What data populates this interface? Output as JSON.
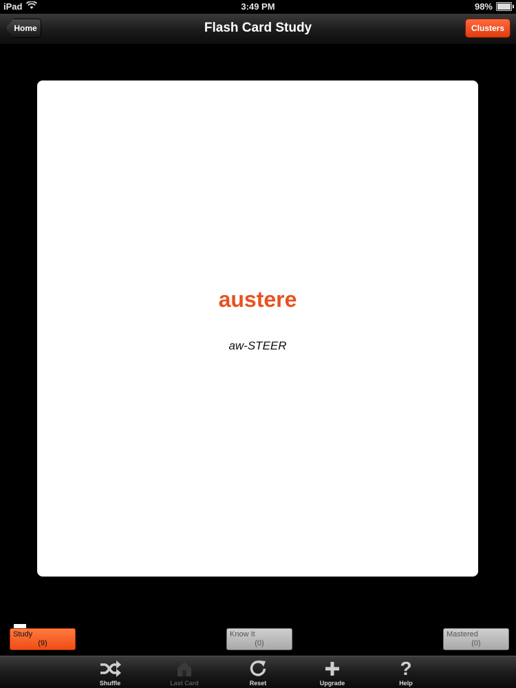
{
  "status_bar": {
    "device": "iPad",
    "time": "3:49 PM",
    "battery": "98%",
    "battery_level": 0.98,
    "wifi_icon": "wifi-icon",
    "battery_icon": "battery-icon"
  },
  "nav": {
    "title": "Flash Card Study",
    "home_label": "Home",
    "clusters_label": "Clusters",
    "accent_color": "#e8521f"
  },
  "card": {
    "word": "austere",
    "pronunciation": "aw-STEER",
    "word_color": "#e8521f"
  },
  "piles": [
    {
      "label": "Study",
      "count": "(9)",
      "active": true
    },
    {
      "label": "Know It",
      "count": "(0)",
      "active": false
    },
    {
      "label": "Mastered",
      "count": "(0)",
      "active": false
    }
  ],
  "toolbar": {
    "items": [
      {
        "label": "Shuffle",
        "icon": "shuffle-icon",
        "enabled": true
      },
      {
        "label": "Last Card",
        "icon": "last-card-icon",
        "enabled": false
      },
      {
        "label": "Reset",
        "icon": "reset-icon",
        "enabled": true
      },
      {
        "label": "Upgrade",
        "icon": "plus-icon",
        "enabled": true
      },
      {
        "label": "Help",
        "icon": "help-icon",
        "enabled": true
      }
    ]
  }
}
